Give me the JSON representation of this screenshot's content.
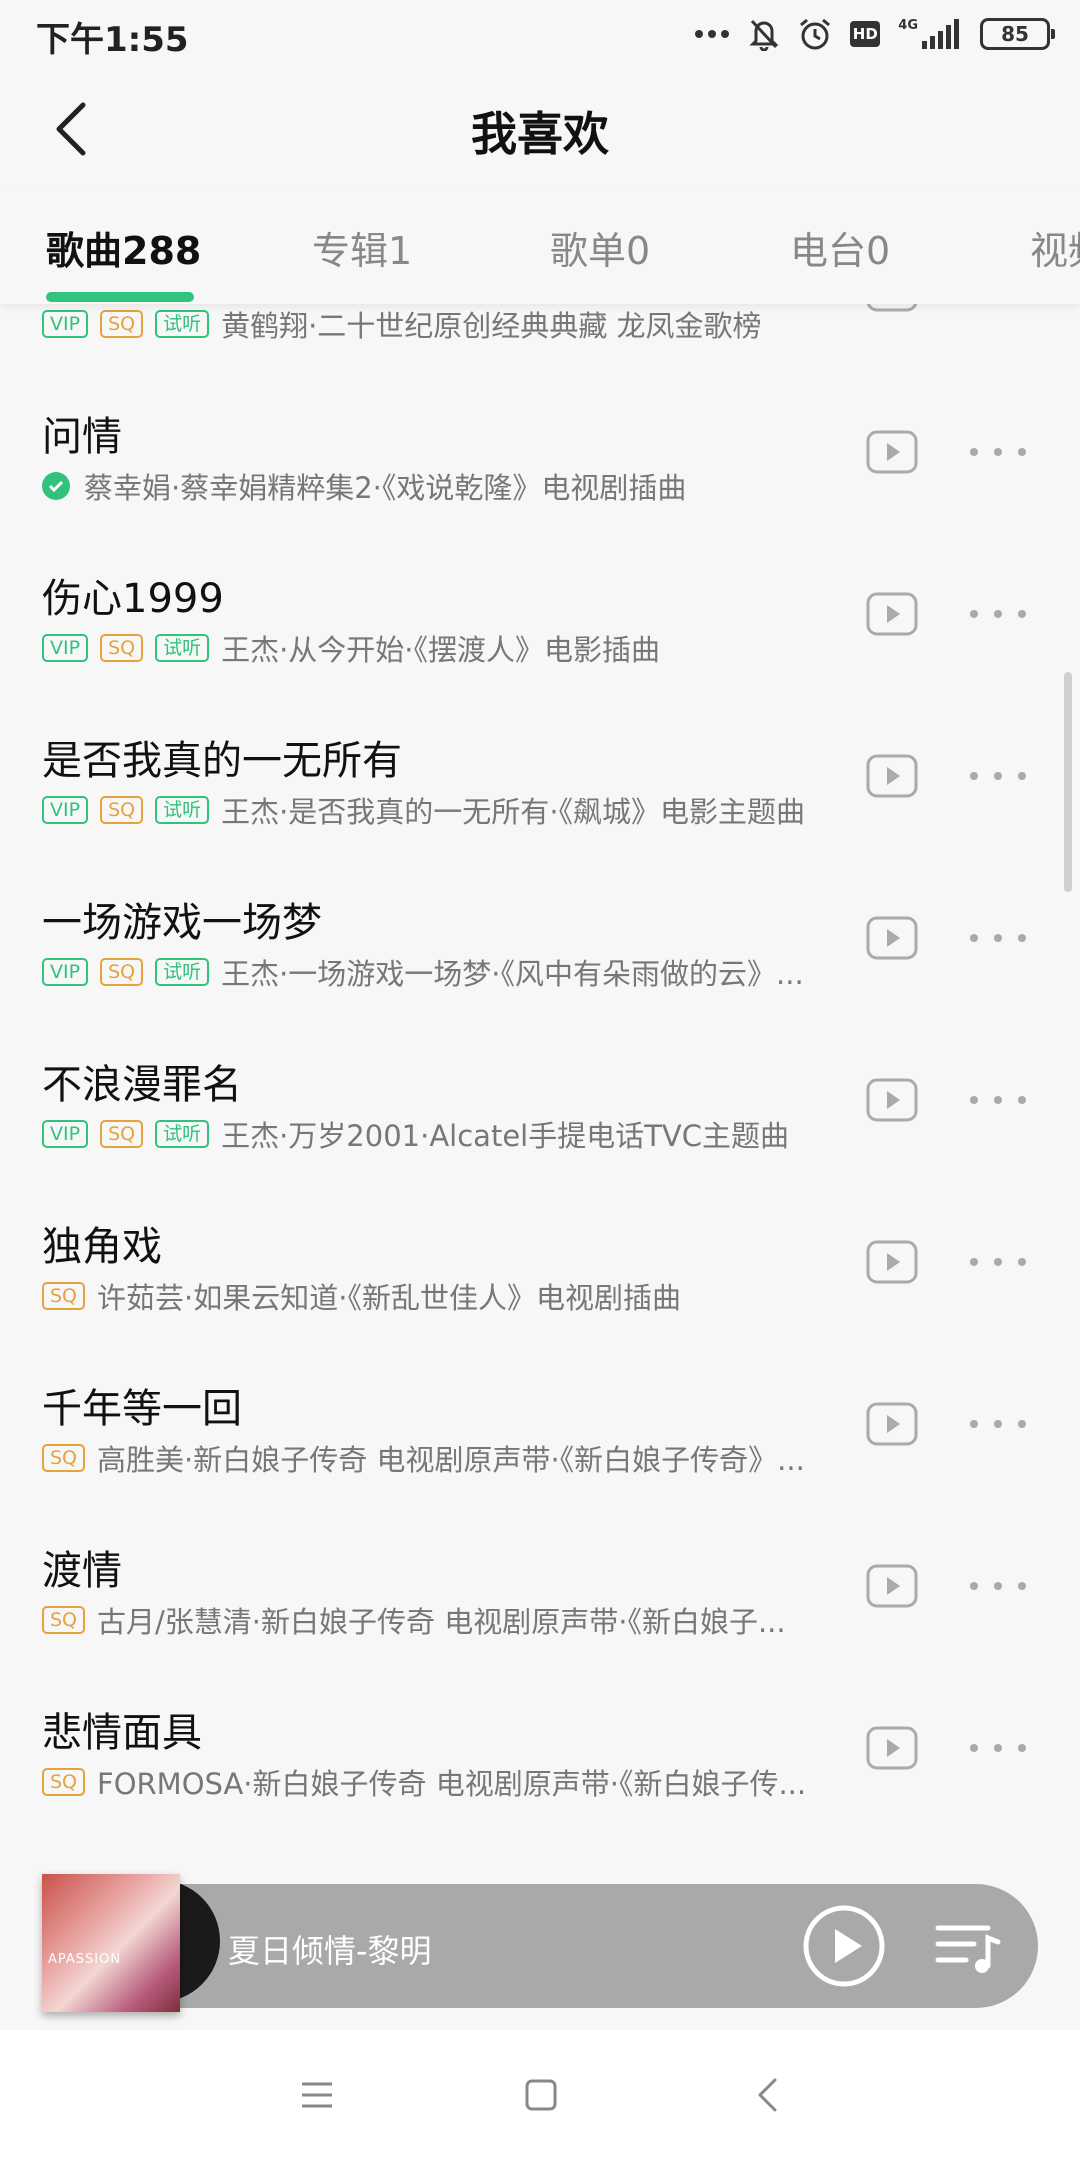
{
  "status_bar": {
    "time": "下午1:55",
    "hd": "HD",
    "network": "4G",
    "battery": "85",
    "icons": [
      "more-dots-icon",
      "mute-bell-icon",
      "alarm-icon",
      "hd-icon",
      "signal-icon",
      "battery-icon"
    ]
  },
  "header": {
    "title": "我喜欢",
    "back_icon": "chevron-left-icon"
  },
  "tabs": [
    {
      "label": "歌曲288",
      "active": true
    },
    {
      "label": "专辑1",
      "active": false
    },
    {
      "label": "歌单0",
      "active": false
    },
    {
      "label": "电台0",
      "active": false
    },
    {
      "label": "视频",
      "active": false
    }
  ],
  "songs": [
    {
      "title": "",
      "tags": [
        "VIP",
        "SQ",
        "试听"
      ],
      "meta": "黄鹤翔·二十世纪原创经典典藏 龙凤金歌榜"
    },
    {
      "title": "问情",
      "tags": [],
      "downloaded": true,
      "meta": "蔡幸娟·蔡幸娟精粹集2·《戏说乾隆》电视剧插曲"
    },
    {
      "title": "伤心1999",
      "tags": [
        "VIP",
        "SQ",
        "试听"
      ],
      "meta": "王杰·从今开始·《摆渡人》电影插曲"
    },
    {
      "title": "是否我真的一无所有",
      "tags": [
        "VIP",
        "SQ",
        "试听"
      ],
      "meta": "王杰·是否我真的一无所有·《飙城》电影主题曲"
    },
    {
      "title": "一场游戏一场梦",
      "tags": [
        "VIP",
        "SQ",
        "试听"
      ],
      "meta": "王杰·一场游戏一场梦·《风中有朵雨做的云》..."
    },
    {
      "title": "不浪漫罪名",
      "tags": [
        "VIP",
        "SQ",
        "试听"
      ],
      "meta": "王杰·万岁2001·Alcatel手提电话TVC主题曲"
    },
    {
      "title": "独角戏",
      "tags": [
        "SQ"
      ],
      "meta": "许茹芸·如果云知道·《新乱世佳人》电视剧插曲"
    },
    {
      "title": "千年等一回",
      "tags": [
        "SQ"
      ],
      "meta": "高胜美·新白娘子传奇 电视剧原声带·《新白娘子传奇》..."
    },
    {
      "title": "渡情",
      "tags": [
        "SQ"
      ],
      "meta": "古月/张慧清·新白娘子传奇 电视剧原声带·《新白娘子..."
    },
    {
      "title": "悲情面具",
      "tags": [
        "SQ"
      ],
      "meta": "FORMOSA·新白娘子传奇 电视剧原声带·《新白娘子传..."
    }
  ],
  "player": {
    "now_playing": "夏日倾情-黎明",
    "cover_text": "APASSION",
    "play_icon": "play-circle-icon",
    "queue_icon": "playlist-icon"
  },
  "colors": {
    "accent": "#31c27c",
    "sq": "#e6a23c",
    "player_bg": "#a9a9a9"
  },
  "nav": [
    "menu-icon",
    "home-square-icon",
    "back-triangle-icon"
  ]
}
